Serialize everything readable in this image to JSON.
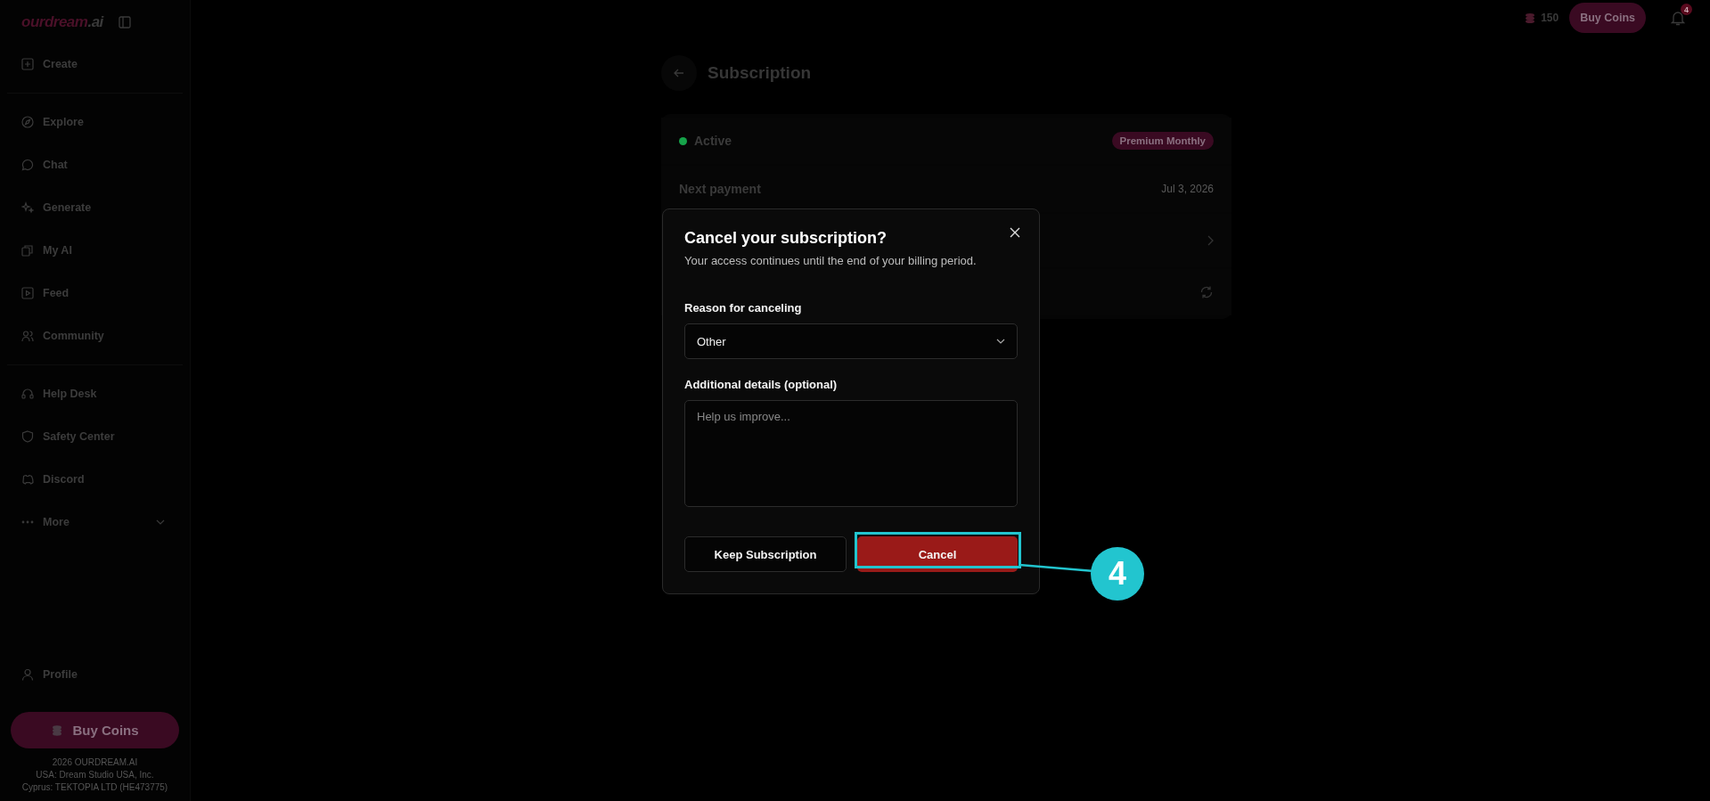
{
  "logo": {
    "text": "ourdream",
    "suffix": ".ai"
  },
  "sidebar": {
    "groups": [
      [
        {
          "label": "Create"
        }
      ],
      [
        {
          "label": "Explore"
        },
        {
          "label": "Chat"
        },
        {
          "label": "Generate"
        },
        {
          "label": "My AI"
        },
        {
          "label": "Feed"
        },
        {
          "label": "Community"
        }
      ],
      [
        {
          "label": "Help Desk"
        },
        {
          "label": "Safety Center"
        },
        {
          "label": "Discord"
        },
        {
          "label": "More",
          "expandable": true
        }
      ]
    ],
    "profile": "Profile",
    "buy_coins": "Buy Coins",
    "footer": [
      "2026 OURDREAM.AI",
      "USA: Dream Studio USA, Inc.",
      "Cyprus: TEKTOPIA LTD (HE473775)"
    ]
  },
  "topbar": {
    "coins": "150",
    "buy_coins": "Buy Coins",
    "notifications": "4"
  },
  "page": {
    "title": "Subscription",
    "status": {
      "label": "Active",
      "color": "#16a34a"
    },
    "plan": "Premium Monthly",
    "next_payment": {
      "label": "Next payment",
      "value": "Jul 3, 2026"
    }
  },
  "dialog": {
    "title": "Cancel your subscription?",
    "subtitle": "Your access continues until the end of your billing period.",
    "reason_label": "Reason for canceling",
    "reason_value": "Other",
    "details_label": "Additional details (optional)",
    "details_placeholder": "Help us improve...",
    "keep_button": "Keep Subscription",
    "cancel_button": "Cancel"
  },
  "annotation": {
    "number": "4"
  }
}
